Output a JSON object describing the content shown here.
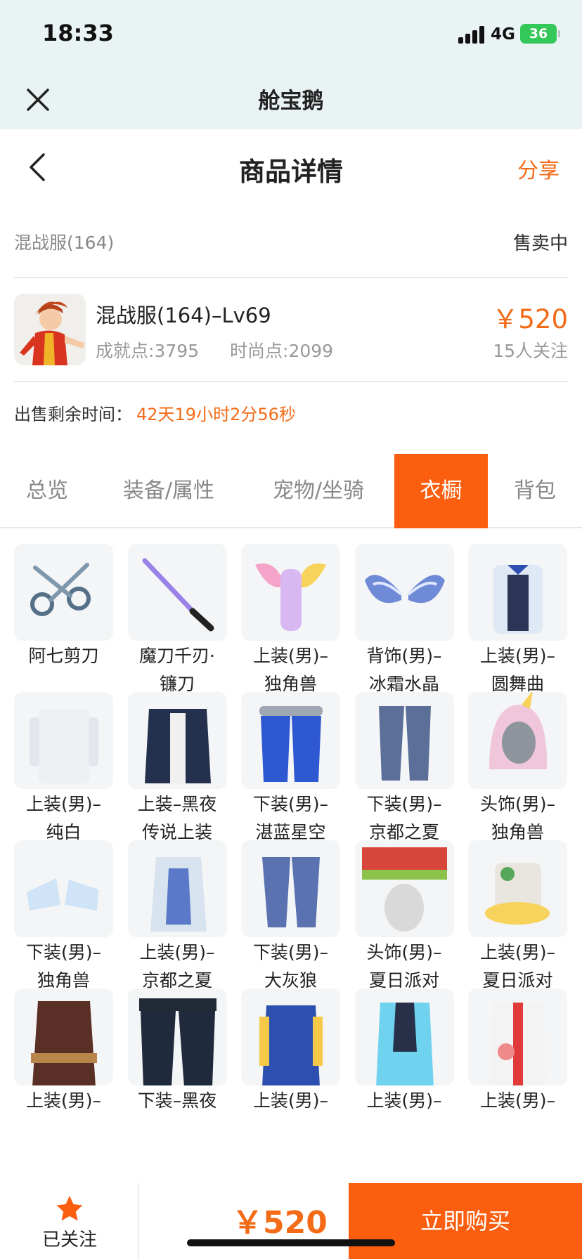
{
  "status_bar": {
    "time": "18:33",
    "network": "4G",
    "battery": "36"
  },
  "app": {
    "title": "舱宝鹅"
  },
  "nav": {
    "title": "商品详情",
    "share": "分享"
  },
  "listing": {
    "server": "混战服(164)",
    "status": "售卖中",
    "title": "混战服(164)–Lv69",
    "achievement": "成就点:3795",
    "fashion": "时尚点:2099",
    "price": "￥520",
    "followers": "15人关注",
    "remaining_label": "出售剩余时间：",
    "remaining_value": "42天19小时2分56秒"
  },
  "tabs": [
    {
      "label": "总览",
      "active": false
    },
    {
      "label": "装备/属性",
      "active": false
    },
    {
      "label": "宠物/坐骑",
      "active": false
    },
    {
      "label": "衣橱",
      "active": true
    },
    {
      "label": "背包",
      "active": false
    }
  ],
  "wardrobe": [
    {
      "line1": "阿七剪刀",
      "line2": "",
      "icon": "scissors-icon"
    },
    {
      "line1": "魔刀千刃·",
      "line2": "镰刀",
      "icon": "blade-icon"
    },
    {
      "line1": "上装(男)–",
      "line2": "独角兽",
      "icon": "unicorn-top-icon"
    },
    {
      "line1": "背饰(男)–",
      "line2": "冰霜水晶",
      "icon": "frost-wings-icon"
    },
    {
      "line1": "上装(男)–",
      "line2": "圆舞曲",
      "icon": "waltz-top-icon"
    },
    {
      "line1": "上装(男)–",
      "line2": "纯白",
      "icon": "white-top-icon"
    },
    {
      "line1": "上装–黑夜",
      "line2": "传说上装",
      "icon": "night-top-icon"
    },
    {
      "line1": "下装(男)–",
      "line2": "湛蓝星空",
      "icon": "blue-pants-icon"
    },
    {
      "line1": "下装(男)–",
      "line2": "京都之夏",
      "icon": "kyoto-pants-icon"
    },
    {
      "line1": "头饰(男)–",
      "line2": "独角兽",
      "icon": "unicorn-hood-icon"
    },
    {
      "line1": "下装(男)–",
      "line2": "独角兽",
      "icon": "unicorn-boots-icon"
    },
    {
      "line1": "上装(男)–",
      "line2": "京都之夏",
      "icon": "kyoto-top-icon"
    },
    {
      "line1": "下装(男)–",
      "line2": "大灰狼",
      "icon": "wolf-pants-icon"
    },
    {
      "line1": "头饰(男)–",
      "line2": "夏日派对",
      "icon": "party-hat-icon"
    },
    {
      "line1": "上装(男)–",
      "line2": "夏日派对",
      "icon": "party-top-icon"
    },
    {
      "line1": "上装(男)–",
      "line2": "",
      "icon": "pirate-top-icon"
    },
    {
      "line1": "下装–黑夜",
      "line2": "",
      "icon": "night-pants-icon"
    },
    {
      "line1": "上装(男)–",
      "line2": "",
      "icon": "varsity-top-icon"
    },
    {
      "line1": "上装(男)–",
      "line2": "",
      "icon": "cyan-top-icon"
    },
    {
      "line1": "上装(男)–",
      "line2": "",
      "icon": "red-white-top-icon"
    }
  ],
  "bottom": {
    "follow_label": "已关注",
    "price": "￥520",
    "buy_label": "立即购买"
  },
  "colors": {
    "accent": "#fb5e0e",
    "price": "#f36b17",
    "header_bg": "#eaf3f4"
  }
}
